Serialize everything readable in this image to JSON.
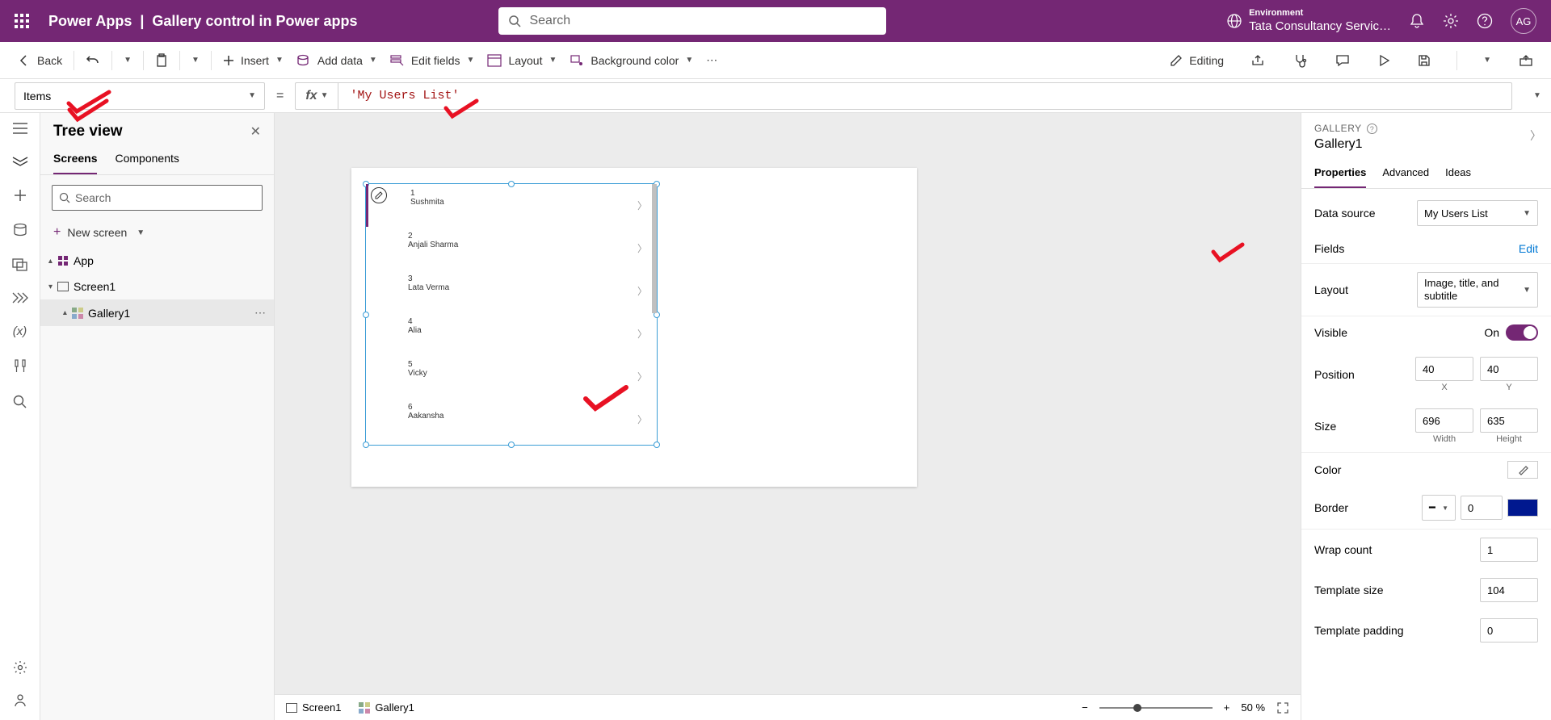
{
  "header": {
    "app_name": "Power Apps",
    "page_title": "Gallery control in Power apps",
    "search_placeholder": "Search",
    "environment_label": "Environment",
    "environment_name": "Tata Consultancy Servic…",
    "avatar_initials": "AG"
  },
  "toolbar": {
    "back": "Back",
    "insert": "Insert",
    "add_data": "Add data",
    "edit_fields": "Edit fields",
    "layout": "Layout",
    "background_color": "Background color",
    "editing": "Editing"
  },
  "formula": {
    "property": "Items",
    "fx_label": "fx",
    "value": "'My Users List'"
  },
  "tree": {
    "title": "Tree view",
    "tab_screens": "Screens",
    "tab_components": "Components",
    "search_placeholder": "Search",
    "new_screen": "New screen",
    "app": "App",
    "screen1": "Screen1",
    "gallery1": "Gallery1"
  },
  "gallery_rows": [
    {
      "num": "1",
      "name": "Sushmita"
    },
    {
      "num": "2",
      "name": "Anjali Sharma"
    },
    {
      "num": "3",
      "name": "Lata Verma"
    },
    {
      "num": "4",
      "name": "Alia"
    },
    {
      "num": "5",
      "name": "Vicky"
    },
    {
      "num": "6",
      "name": "Aakansha"
    }
  ],
  "statusbar": {
    "screen1": "Screen1",
    "gallery1": "Gallery1",
    "zoom": "50",
    "zoom_unit": "%"
  },
  "props": {
    "type": "GALLERY",
    "name": "Gallery1",
    "tab_properties": "Properties",
    "tab_advanced": "Advanced",
    "tab_ideas": "Ideas",
    "data_source_label": "Data source",
    "data_source_value": "My Users List",
    "fields_label": "Fields",
    "fields_edit": "Edit",
    "layout_label": "Layout",
    "layout_value": "Image, title, and subtitle",
    "visible_label": "Visible",
    "visible_value": "On",
    "position_label": "Position",
    "pos_x": "40",
    "pos_y": "40",
    "x_label": "X",
    "y_label": "Y",
    "size_label": "Size",
    "width": "696",
    "height": "635",
    "w_label": "Width",
    "h_label": "Height",
    "color_label": "Color",
    "border_label": "Border",
    "border_width": "0",
    "wrap_label": "Wrap count",
    "wrap_val": "1",
    "tpl_size_label": "Template size",
    "tpl_size_val": "104",
    "tpl_pad_label": "Template padding",
    "tpl_pad_val": "0"
  }
}
